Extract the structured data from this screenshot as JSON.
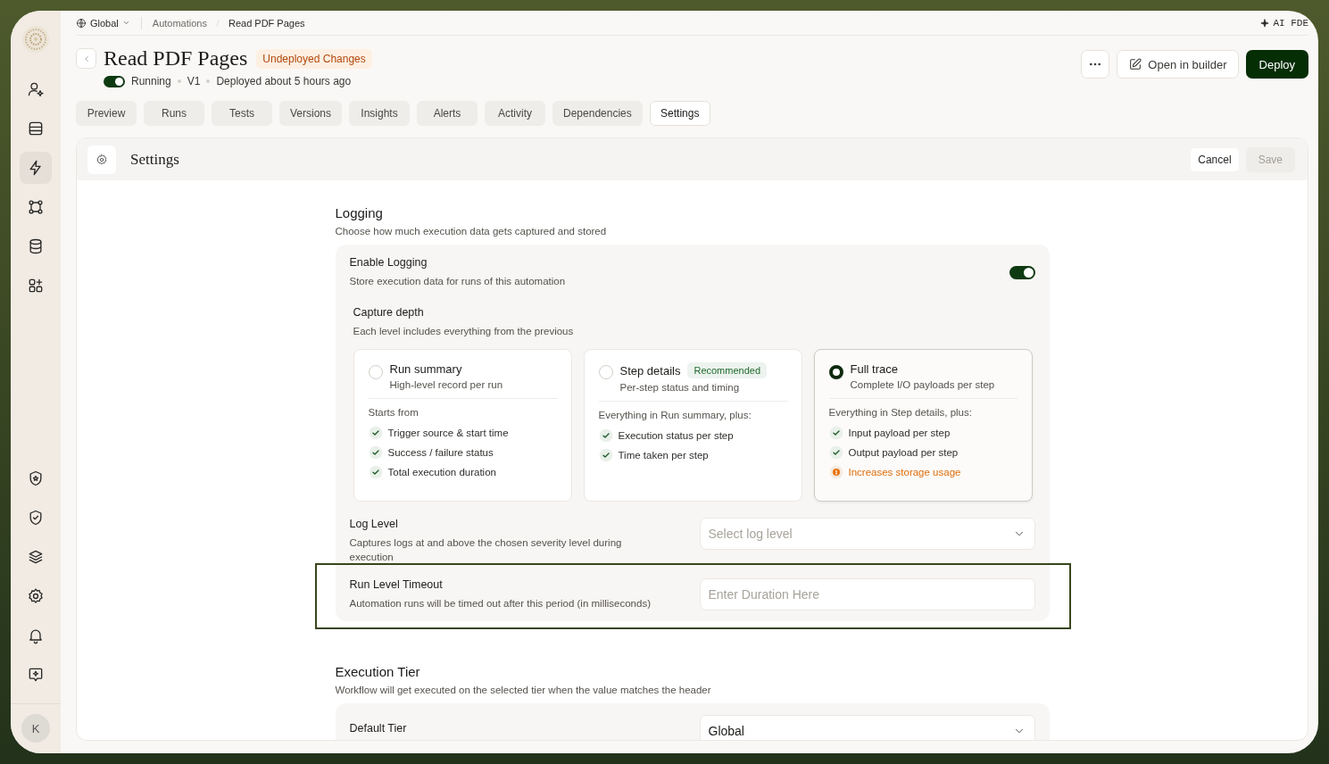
{
  "sidebar": {
    "top_items": [
      {
        "selected": false
      },
      {
        "selected": false
      },
      {
        "selected": true
      },
      {
        "selected": false
      },
      {
        "selected": false
      },
      {
        "selected": false
      }
    ],
    "bottom_items": [
      {
        "selected": false
      },
      {
        "selected": false
      },
      {
        "selected": false
      },
      {
        "selected": false
      },
      {
        "selected": false
      },
      {
        "selected": false
      }
    ],
    "avatar": "K"
  },
  "breadcrumb": {
    "workspace": "Global",
    "items": [
      "Automations",
      "Read PDF Pages"
    ]
  },
  "ai_button": "AI FDE",
  "header": {
    "title": "Read PDF Pages",
    "badge": "Undeployed Changes",
    "running": true,
    "status": "Running",
    "version": "V1",
    "deployed": "Deployed about 5 hours ago"
  },
  "actions": {
    "open_builder": "Open in builder",
    "deploy": "Deploy"
  },
  "tabs": [
    {
      "label": "Preview",
      "selected": false
    },
    {
      "label": "Runs",
      "selected": false
    },
    {
      "label": "Tests",
      "selected": false
    },
    {
      "label": "Versions",
      "selected": false
    },
    {
      "label": "Insights",
      "selected": false
    },
    {
      "label": "Alerts",
      "selected": false
    },
    {
      "label": "Activity",
      "selected": false
    },
    {
      "label": "Dependencies",
      "selected": false
    },
    {
      "label": "Settings",
      "selected": true
    }
  ],
  "panel": {
    "title": "Settings",
    "cancel": "Cancel",
    "save": {
      "label": "Save",
      "disabled": true
    }
  },
  "logging": {
    "title": "Logging",
    "description": "Choose how much execution data gets captured and stored",
    "enable": {
      "label": "Enable Logging",
      "description": "Store execution data for runs of this automation",
      "on": true
    },
    "capture": {
      "title": "Capture depth",
      "description": "Each level includes everything from the previous",
      "options": [
        {
          "title": "Run summary",
          "subtitle": "High-level record per run",
          "selected": false,
          "intro": "Starts from",
          "items": [
            {
              "text": "Trigger source & start time",
              "kind": "check"
            },
            {
              "text": "Success / failure status",
              "kind": "check"
            },
            {
              "text": "Total execution duration",
              "kind": "check"
            }
          ]
        },
        {
          "title": "Step details",
          "badge": "Recommended",
          "subtitle": "Per-step status and timing",
          "selected": false,
          "intro": "Everything in Run summary, plus:",
          "items": [
            {
              "text": "Execution status per step",
              "kind": "check"
            },
            {
              "text": "Time taken per step",
              "kind": "check"
            }
          ]
        },
        {
          "title": "Full trace",
          "subtitle": "Complete I/O payloads per step",
          "selected": true,
          "intro": "Everything in Step details, plus:",
          "items": [
            {
              "text": "Input payload per step",
              "kind": "check"
            },
            {
              "text": "Output payload per step",
              "kind": "check"
            },
            {
              "text": "Increases storage usage",
              "kind": "warning"
            }
          ]
        }
      ]
    },
    "log_level": {
      "label": "Log Level",
      "description": "Captures logs at and above the chosen severity level during execution",
      "placeholder": "Select log level"
    },
    "timeout": {
      "label": "Run Level Timeout",
      "description": "Automation runs will be timed out after this period (in milliseconds)",
      "placeholder": "Enter Duration Here",
      "highlighted": true
    }
  },
  "execution_tier": {
    "title": "Execution Tier",
    "description": "Workflow will get executed on the selected tier when the value matches the header",
    "default_tier": {
      "label": "Default Tier",
      "value": "Global"
    }
  }
}
